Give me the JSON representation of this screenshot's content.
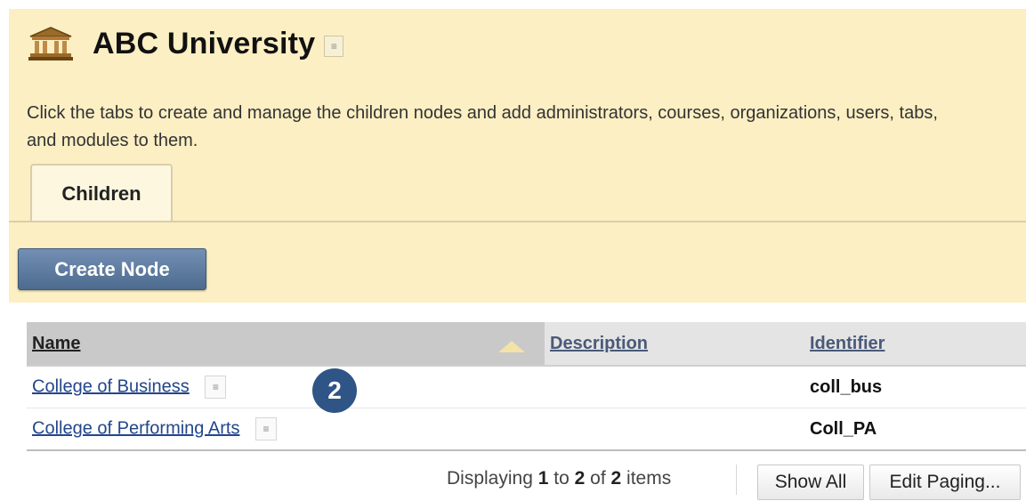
{
  "header": {
    "title": "ABC University",
    "title_menu_icon": "chevron-double-down-icon",
    "institution_icon": "bank-building-icon",
    "instructions": "Click the tabs to create and manage the children nodes and add administrators, courses, organizations, users, tabs, and modules to them."
  },
  "tabs": [
    {
      "label": "Children",
      "active": true
    }
  ],
  "toolbar": {
    "create_label": "Create Node"
  },
  "table": {
    "columns": {
      "name": "Name",
      "description": "Description",
      "identifier": "Identifier"
    },
    "sort_column": "Name",
    "sort_direction": "ascending",
    "rows": [
      {
        "name": "College of Business",
        "description": "",
        "identifier": "coll_bus"
      },
      {
        "name": "College of Performing Arts",
        "description": "",
        "identifier": "Coll_PA"
      }
    ]
  },
  "callout": "2",
  "paging": {
    "prefix": "Displaying",
    "from": "1",
    "to_word": "to",
    "to": "2",
    "of_word": "of",
    "total": "2",
    "suffix": "items",
    "show_all": "Show All",
    "edit_paging": "Edit Paging..."
  },
  "colors": {
    "header_bg": "#fbefc3",
    "button_blue": "#5874a0",
    "link": "#23468b",
    "callout_bg": "#2f5486"
  }
}
